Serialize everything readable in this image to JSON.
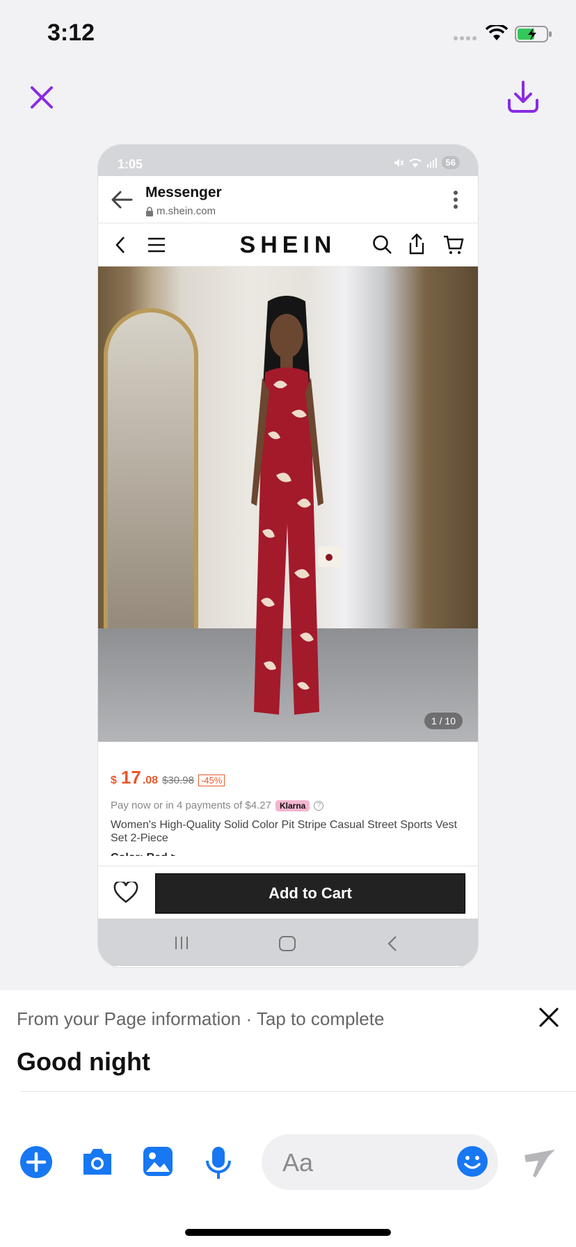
{
  "status_bar": {
    "time": "3:12"
  },
  "screenshot": {
    "status_time": "1:05",
    "status_battery": "56",
    "app_bar": {
      "title": "Messenger",
      "url": "m.shein.com"
    },
    "store": {
      "logo": "SHEIN"
    },
    "image_counter": "1 / 10",
    "price": {
      "currency": "$",
      "whole": "17",
      "cents": ".08",
      "original": "$30.98",
      "discount": "-45%"
    },
    "payment": {
      "text": "Pay now or in 4 payments of $4.27",
      "provider": "Klarna",
      "help": "?"
    },
    "product_title": "Women's High-Quality Solid Color Pit Stripe Casual Street Sports Vest Set 2-Piece",
    "cutoff_text": "Color: Red >",
    "add_to_cart_label": "Add to Cart"
  },
  "sheet": {
    "hint": "From your Page information · Tap to complete",
    "draft_text": "Good night"
  },
  "composer": {
    "placeholder": "Aa"
  },
  "colors": {
    "accent": "#8a2be2",
    "messenger_blue": "#1877f2",
    "price": "#e8582a"
  }
}
